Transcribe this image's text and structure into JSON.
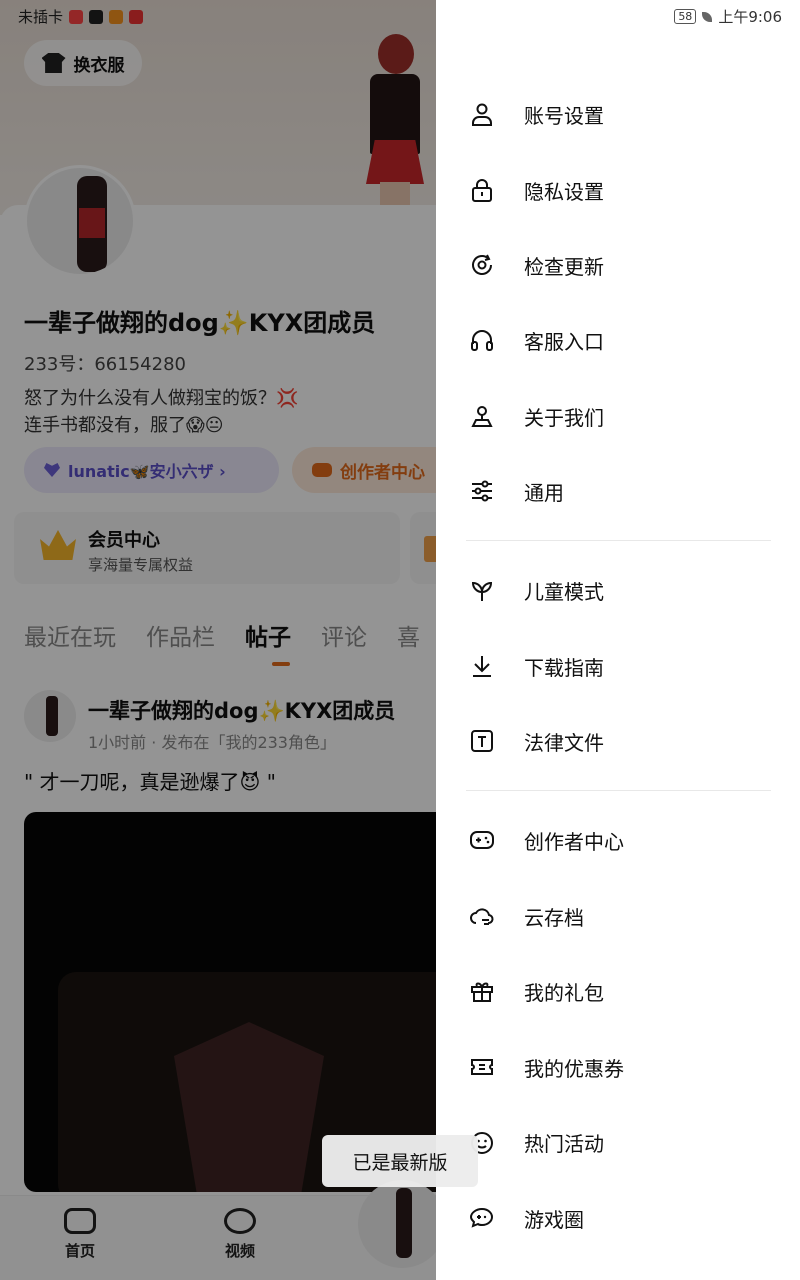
{
  "status_bar": {
    "carrier": "未插卡",
    "battery": "58",
    "time": "上午9:06"
  },
  "profile": {
    "dress_button": "换衣服",
    "nickname": "一辈子做翔的dog✨KYX团成员",
    "uid": "233号：66154280",
    "bio_line1": "怒了为什么没有人做翔宝的饭？💢",
    "bio_line2": "连手书都没有，服了😱😐",
    "chip_lunatic": "lunatic🦋安小六ザ ›",
    "chip_creator": "创作者中心",
    "vip_title": "会员中心",
    "vip_subtitle": "享海量专属权益",
    "tabs": [
      "最近在玩",
      "作品栏",
      "帖子",
      "评论",
      "喜"
    ],
    "active_tab": "帖子"
  },
  "post": {
    "author": "一辈子做翔的dog✨KYX团成员",
    "meta": "1小时前 · 发布在「我的233角色」",
    "text": "\" 才一刀呢，真是逊爆了😈 \""
  },
  "bottom_nav": {
    "home": "首页",
    "video": "视频"
  },
  "drawer": {
    "group1": [
      {
        "label": "账号设置",
        "icon": "user-icon"
      },
      {
        "label": "隐私设置",
        "icon": "lock-icon"
      },
      {
        "label": "检查更新",
        "icon": "refresh-icon"
      },
      {
        "label": "客服入口",
        "icon": "headset-icon"
      },
      {
        "label": "关于我们",
        "icon": "about-icon"
      },
      {
        "label": "通用",
        "icon": "sliders-icon"
      }
    ],
    "group2": [
      {
        "label": "儿童模式",
        "icon": "sprout-icon"
      },
      {
        "label": "下载指南",
        "icon": "download-icon"
      },
      {
        "label": "法律文件",
        "icon": "document-icon"
      }
    ],
    "group3": [
      {
        "label": "创作者中心",
        "icon": "gamepad-icon"
      },
      {
        "label": "云存档",
        "icon": "cloud-icon"
      },
      {
        "label": "我的礼包",
        "icon": "gift-icon"
      },
      {
        "label": "我的优惠券",
        "icon": "ticket-icon"
      },
      {
        "label": "热门活动",
        "icon": "smile-icon"
      },
      {
        "label": "游戏圈",
        "icon": "chat-game-icon"
      }
    ]
  },
  "toast": "已是最新版"
}
